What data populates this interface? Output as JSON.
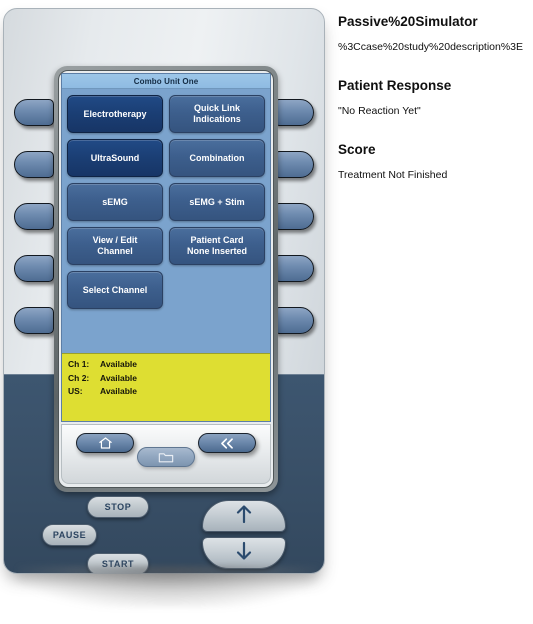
{
  "device": {
    "screen": {
      "title": "Combo Unit One",
      "buttons": [
        {
          "label": "Electrotherapy",
          "state": "active"
        },
        {
          "label": "Quick Link\nIndications",
          "state": "normal"
        },
        {
          "label": "UltraSound",
          "state": "active"
        },
        {
          "label": "Combination",
          "state": "normal"
        },
        {
          "label": "sEMG",
          "state": "normal"
        },
        {
          "label": "sEMG + Stim",
          "state": "normal"
        },
        {
          "label": "View / Edit\nChannel",
          "state": "normal"
        },
        {
          "label": "Patient Card\nNone Inserted",
          "state": "normal"
        },
        {
          "label": "Select Channel",
          "state": "normal"
        }
      ],
      "status": [
        {
          "key": "Ch 1:",
          "value": "Available"
        },
        {
          "key": "Ch 2:",
          "value": "Available"
        },
        {
          "key": "US:",
          "value": "Available"
        }
      ],
      "nav": {
        "home": "home-icon",
        "folder": "folder-icon",
        "back": "double-chevron-left-icon"
      }
    },
    "controls": {
      "stop": "STOP",
      "pause": "PAUSE",
      "start": "START",
      "up": "up-arrow-icon",
      "down": "down-arrow-icon"
    },
    "side_buttons": {
      "left_count": 5,
      "right_count": 5
    }
  },
  "info": {
    "title": "Passive%20Simulator",
    "description": "%3Ccase%20study%20description%3E",
    "patient_response_heading": "Patient Response",
    "patient_response_value": "\"No Reaction Yet\"",
    "score_heading": "Score",
    "score_value": "Treatment Not Finished"
  },
  "colors": {
    "lcd_background": "#7ba3cd",
    "button_active": "#1b3f75",
    "button_normal": "#3d5f8d",
    "status_panel": "#dede32",
    "console": "#3a5169"
  }
}
